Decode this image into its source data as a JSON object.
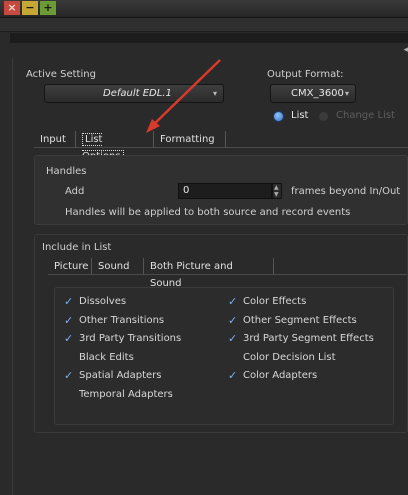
{
  "window": {
    "controls": {
      "close": "×",
      "minimize": "−",
      "maximize": "+"
    },
    "scroll_arrow": "◂"
  },
  "active_setting": {
    "label": "Active Setting",
    "value": "Default EDL.1"
  },
  "output_format": {
    "label": "Output Format:",
    "value": "CMX_3600",
    "radio_list": "List",
    "radio_change_list": "Change List",
    "selected": "List"
  },
  "tabs": [
    {
      "label": "Input",
      "selected": false
    },
    {
      "label": "List Options",
      "selected": true
    },
    {
      "label": "Formatting",
      "selected": false
    }
  ],
  "handles": {
    "title": "Handles",
    "add_label": "Add",
    "add_value": "0",
    "suffix": "frames beyond In/Out",
    "note": "Handles will be applied to both source and record events"
  },
  "include": {
    "title": "Include in List",
    "subtabs": [
      {
        "label": "Picture",
        "selected": true
      },
      {
        "label": "Sound",
        "selected": false
      },
      {
        "label": "Both Picture and Sound",
        "selected": false
      }
    ],
    "left_items": [
      {
        "label": "Dissolves",
        "checked": true
      },
      {
        "label": "Other Transitions",
        "checked": true
      },
      {
        "label": "3rd Party Transitions",
        "checked": true
      },
      {
        "label": "Black Edits",
        "checked": false
      },
      {
        "label": "Spatial Adapters",
        "checked": true
      },
      {
        "label": "Temporal Adapters",
        "checked": false
      }
    ],
    "right_items": [
      {
        "label": "Color Effects",
        "checked": true
      },
      {
        "label": "Other Segment Effects",
        "checked": true
      },
      {
        "label": "3rd Party Segment Effects",
        "checked": true
      },
      {
        "label": "Color Decision List",
        "checked": false
      },
      {
        "label": "Color Adapters",
        "checked": true
      }
    ]
  },
  "colors": {
    "background": "#2a2a2a",
    "accent_blue": "#7fb0ea",
    "annotation_arrow": "#d83a2c"
  }
}
